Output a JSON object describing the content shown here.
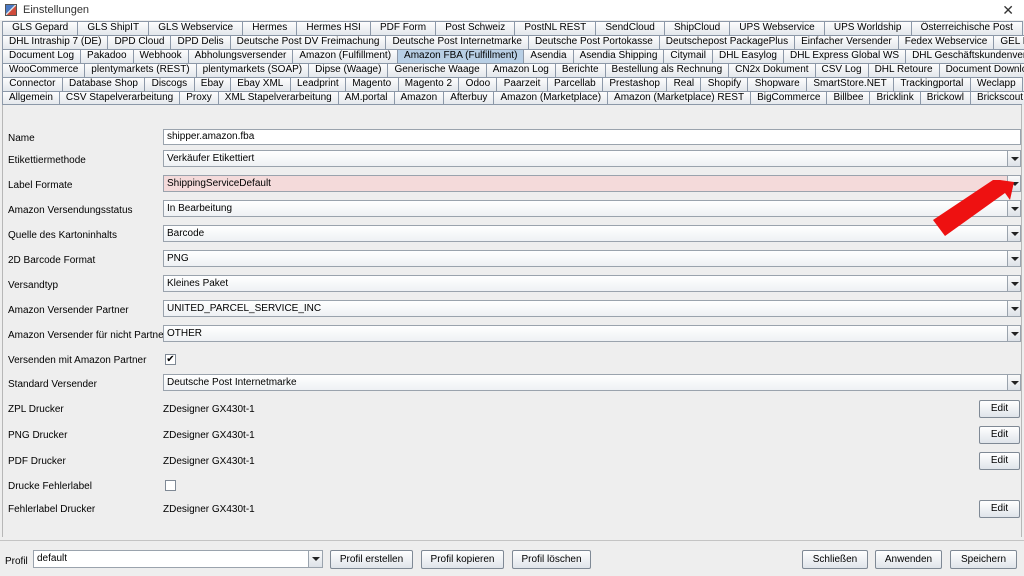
{
  "window": {
    "title": "Einstellungen",
    "close": "✕"
  },
  "tab_rows": [
    [
      "GLS Gepard",
      "GLS ShipIT",
      "GLS Webservice",
      "Hermes",
      "Hermes HSI",
      "PDF Form",
      "Post Schweiz",
      "PostNL REST",
      "SendCloud",
      "ShipCloud",
      "UPS Webservice",
      "UPS Worldship",
      "Österreichische Post"
    ],
    [
      "DHL Intraship 7 (DE)",
      "DPD Cloud",
      "DPD Delis",
      "Deutsche Post DV Freimachung",
      "Deutsche Post Internetmarke",
      "Deutsche Post Portokasse",
      "Deutschepost PackagePlus",
      "Einfacher Versender",
      "Fedex Webservice",
      "GEL Express"
    ],
    [
      "Document Log",
      "Pakadoo",
      "Webhook",
      "Abholungsversender",
      "Amazon (Fulfillment)",
      "Amazon FBA (Fulfillment)",
      "Asendia",
      "Asendia Shipping",
      "Citymail",
      "DHL Easylog",
      "DHL Express Global WS",
      "DHL Geschäftskundenversand"
    ],
    [
      "WooCommerce",
      "plentymarkets (REST)",
      "plentymarkets (SOAP)",
      "Dipse (Waage)",
      "Generische Waage",
      "Amazon Log",
      "Berichte",
      "Bestellung als Rechnung",
      "CN2x Dokument",
      "CSV Log",
      "DHL Retoure",
      "Document Downloader"
    ],
    [
      "Connector",
      "Database Shop",
      "Discogs",
      "Ebay",
      "Ebay XML",
      "Leadprint",
      "Magento",
      "Magento 2",
      "Odoo",
      "Paarzeit",
      "Parcellab",
      "Prestashop",
      "Real",
      "Shopify",
      "Shopware",
      "SmartStore.NET",
      "Trackingportal",
      "Weclapp"
    ],
    [
      "Allgemein",
      "CSV Stapelverarbeitung",
      "Proxy",
      "XML Stapelverarbeitung",
      "AM.portal",
      "Amazon",
      "Afterbuy",
      "Amazon (Marketplace)",
      "Amazon (Marketplace) REST",
      "BigCommerce",
      "Billbee",
      "Bricklink",
      "Brickowl",
      "Brickscout"
    ]
  ],
  "active_tab": "Amazon FBA (Fulfillment)",
  "form": {
    "name_label": "Name",
    "name_value": "shipper.amazon.fba",
    "etikettiermethode_label": "Etikettiermethode",
    "etikettiermethode_value": "Verkäufer Etikettiert",
    "label_formate_label": "Label Formate",
    "label_formate_value": "ShippingServiceDefault",
    "versandstatus_label": "Amazon Versendungsstatus",
    "versandstatus_value": "In Bearbeitung",
    "kartoninhalt_label": "Quelle des Kartoninhalts",
    "kartoninhalt_value": "Barcode",
    "barcode_format_label": "2D Barcode Format",
    "barcode_format_value": "PNG",
    "versandtyp_label": "Versandtyp",
    "versandtyp_value": "Kleines Paket",
    "versender_partner_label": "Amazon Versender Partner",
    "versender_partner_value": "UNITED_PARCEL_SERVICE_INC",
    "nicht_partner_label": "Amazon Versender für nicht Partner",
    "nicht_partner_value": "OTHER",
    "mit_partner_label": "Versenden mit Amazon Partner",
    "mit_partner_checked": "✔",
    "standard_versender_label": "Standard Versender",
    "standard_versender_value": "Deutsche Post Internetmarke",
    "zpl_label": "ZPL Drucker",
    "zpl_value": "ZDesigner GX430t-1",
    "png_label": "PNG Drucker",
    "png_value": "ZDesigner GX430t-1",
    "pdf_label": "PDF Drucker",
    "pdf_value": "ZDesigner GX430t-1",
    "fehlerlabel_label": "Drucke Fehlerlabel",
    "fehlerlabel_drucker_label": "Fehlerlabel Drucker",
    "fehlerlabel_drucker_value": "ZDesigner GX430t-1",
    "edit_label": "Edit"
  },
  "footer": {
    "profil_label": "Profil",
    "profil_value": "default",
    "profil_erstellen": "Profil erstellen",
    "profil_kopieren": "Profil kopieren",
    "profil_loeschen": "Profil löschen",
    "schliessen": "Schließen",
    "anwenden": "Anwenden",
    "speichern": "Speichern"
  },
  "colors": {
    "active_tab": "#b8cfe5",
    "invalid_field": "#f4dada",
    "annotation_arrow": "#ee1111"
  }
}
